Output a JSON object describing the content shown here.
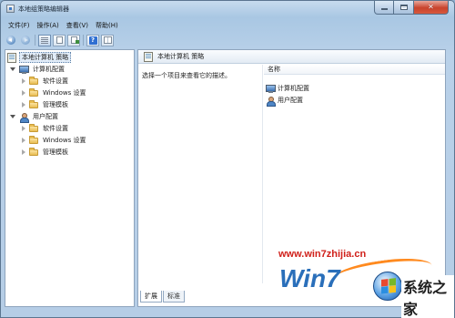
{
  "window": {
    "title": "本地组策略编辑器",
    "icon": "policy-editor-icon"
  },
  "menubar": {
    "items": [
      "文件(F)",
      "操作(A)",
      "查看(V)",
      "帮助(H)"
    ]
  },
  "toolbar": {
    "buttons": [
      "back-arrow-icon",
      "forward-arrow-icon",
      "show-hide-tree-icon",
      "properties-icon",
      "export-list-icon",
      "help-icon",
      "show-hide-action-pane-icon"
    ]
  },
  "tree": {
    "root": "本地计算机 策略",
    "computer_config": "计算机配置",
    "computer_children": [
      "软件设置",
      "Windows 设置",
      "管理模板"
    ],
    "user_config": "用户配置",
    "user_children": [
      "软件设置",
      "Windows 设置",
      "管理模板"
    ]
  },
  "details": {
    "header": "本地计算机 策略",
    "description": "选择一个项目来查看它的描述。",
    "column_name": "名称",
    "rows": [
      "计算机配置",
      "用户配置"
    ]
  },
  "tabs": [
    "扩展",
    "标准"
  ],
  "watermark": {
    "url": "www.win7zhijia.cn",
    "logo_text": "Win7",
    "brand": "系统之家"
  }
}
